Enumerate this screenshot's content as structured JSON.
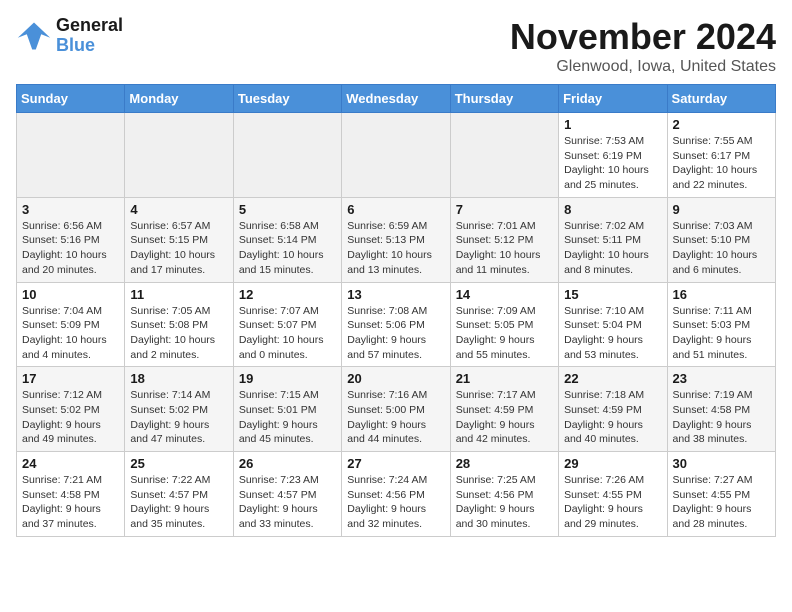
{
  "logo": {
    "line1": "General",
    "line2": "Blue"
  },
  "title": "November 2024",
  "subtitle": "Glenwood, Iowa, United States",
  "days_of_week": [
    "Sunday",
    "Monday",
    "Tuesday",
    "Wednesday",
    "Thursday",
    "Friday",
    "Saturday"
  ],
  "weeks": [
    [
      {
        "day": "",
        "info": ""
      },
      {
        "day": "",
        "info": ""
      },
      {
        "day": "",
        "info": ""
      },
      {
        "day": "",
        "info": ""
      },
      {
        "day": "",
        "info": ""
      },
      {
        "day": "1",
        "info": "Sunrise: 7:53 AM\nSunset: 6:19 PM\nDaylight: 10 hours and 25 minutes."
      },
      {
        "day": "2",
        "info": "Sunrise: 7:55 AM\nSunset: 6:17 PM\nDaylight: 10 hours and 22 minutes."
      }
    ],
    [
      {
        "day": "3",
        "info": "Sunrise: 6:56 AM\nSunset: 5:16 PM\nDaylight: 10 hours and 20 minutes."
      },
      {
        "day": "4",
        "info": "Sunrise: 6:57 AM\nSunset: 5:15 PM\nDaylight: 10 hours and 17 minutes."
      },
      {
        "day": "5",
        "info": "Sunrise: 6:58 AM\nSunset: 5:14 PM\nDaylight: 10 hours and 15 minutes."
      },
      {
        "day": "6",
        "info": "Sunrise: 6:59 AM\nSunset: 5:13 PM\nDaylight: 10 hours and 13 minutes."
      },
      {
        "day": "7",
        "info": "Sunrise: 7:01 AM\nSunset: 5:12 PM\nDaylight: 10 hours and 11 minutes."
      },
      {
        "day": "8",
        "info": "Sunrise: 7:02 AM\nSunset: 5:11 PM\nDaylight: 10 hours and 8 minutes."
      },
      {
        "day": "9",
        "info": "Sunrise: 7:03 AM\nSunset: 5:10 PM\nDaylight: 10 hours and 6 minutes."
      }
    ],
    [
      {
        "day": "10",
        "info": "Sunrise: 7:04 AM\nSunset: 5:09 PM\nDaylight: 10 hours and 4 minutes."
      },
      {
        "day": "11",
        "info": "Sunrise: 7:05 AM\nSunset: 5:08 PM\nDaylight: 10 hours and 2 minutes."
      },
      {
        "day": "12",
        "info": "Sunrise: 7:07 AM\nSunset: 5:07 PM\nDaylight: 10 hours and 0 minutes."
      },
      {
        "day": "13",
        "info": "Sunrise: 7:08 AM\nSunset: 5:06 PM\nDaylight: 9 hours and 57 minutes."
      },
      {
        "day": "14",
        "info": "Sunrise: 7:09 AM\nSunset: 5:05 PM\nDaylight: 9 hours and 55 minutes."
      },
      {
        "day": "15",
        "info": "Sunrise: 7:10 AM\nSunset: 5:04 PM\nDaylight: 9 hours and 53 minutes."
      },
      {
        "day": "16",
        "info": "Sunrise: 7:11 AM\nSunset: 5:03 PM\nDaylight: 9 hours and 51 minutes."
      }
    ],
    [
      {
        "day": "17",
        "info": "Sunrise: 7:12 AM\nSunset: 5:02 PM\nDaylight: 9 hours and 49 minutes."
      },
      {
        "day": "18",
        "info": "Sunrise: 7:14 AM\nSunset: 5:02 PM\nDaylight: 9 hours and 47 minutes."
      },
      {
        "day": "19",
        "info": "Sunrise: 7:15 AM\nSunset: 5:01 PM\nDaylight: 9 hours and 45 minutes."
      },
      {
        "day": "20",
        "info": "Sunrise: 7:16 AM\nSunset: 5:00 PM\nDaylight: 9 hours and 44 minutes."
      },
      {
        "day": "21",
        "info": "Sunrise: 7:17 AM\nSunset: 4:59 PM\nDaylight: 9 hours and 42 minutes."
      },
      {
        "day": "22",
        "info": "Sunrise: 7:18 AM\nSunset: 4:59 PM\nDaylight: 9 hours and 40 minutes."
      },
      {
        "day": "23",
        "info": "Sunrise: 7:19 AM\nSunset: 4:58 PM\nDaylight: 9 hours and 38 minutes."
      }
    ],
    [
      {
        "day": "24",
        "info": "Sunrise: 7:21 AM\nSunset: 4:58 PM\nDaylight: 9 hours and 37 minutes."
      },
      {
        "day": "25",
        "info": "Sunrise: 7:22 AM\nSunset: 4:57 PM\nDaylight: 9 hours and 35 minutes."
      },
      {
        "day": "26",
        "info": "Sunrise: 7:23 AM\nSunset: 4:57 PM\nDaylight: 9 hours and 33 minutes."
      },
      {
        "day": "27",
        "info": "Sunrise: 7:24 AM\nSunset: 4:56 PM\nDaylight: 9 hours and 32 minutes."
      },
      {
        "day": "28",
        "info": "Sunrise: 7:25 AM\nSunset: 4:56 PM\nDaylight: 9 hours and 30 minutes."
      },
      {
        "day": "29",
        "info": "Sunrise: 7:26 AM\nSunset: 4:55 PM\nDaylight: 9 hours and 29 minutes."
      },
      {
        "day": "30",
        "info": "Sunrise: 7:27 AM\nSunset: 4:55 PM\nDaylight: 9 hours and 28 minutes."
      }
    ]
  ]
}
